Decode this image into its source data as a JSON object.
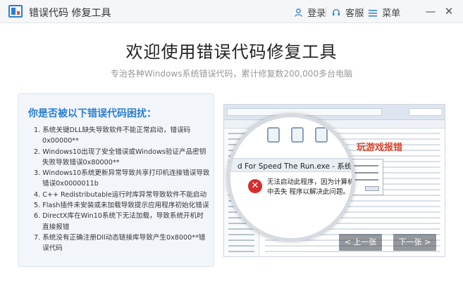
{
  "titlebar": {
    "app_title": "错误代码 修复工具",
    "login_label": "登录",
    "support_label": "客服",
    "menu_label": "菜单",
    "minimize_glyph": "—",
    "close_glyph": "✕"
  },
  "header": {
    "title": "欢迎使用错误代码修复工具",
    "subtitle": "专治各种Windows系统错误代码，累计修复数200,000多台电脑"
  },
  "issues_panel": {
    "title": "你是否被以下错误代码困扰：",
    "items": [
      "1. 系统关键DLL缺失导致软件不能正常启动，错误码0x00000**",
      "2. Windows10出现了安全错误或Windows验证产品密钥失败导致错误0x80000**",
      "3. Windows10系统更新异常导致共享打印机连接错误导致错误0x0000011b",
      "4. C++ Redistributable运行时库异常导致软件不能启动",
      "5. Flash插件未安装或未加载导致提示应用程序初始化错误",
      "6. DirectX库在Win10系统下无法加载，导致系统开机时直接报错",
      "7. 系统没有正确注册Dll动态链接库导致产生0x8000**错误代码"
    ]
  },
  "preview": {
    "magnifier_heading": "d For Speed The Run.exe - 系统错误",
    "error_message": "无法启动此程序，因为计算机中丢失 程序以解决此问题。",
    "category_label": "玩游戏报错",
    "prev_label": "上一张",
    "next_label": "下一张"
  },
  "icons": {
    "login": "user-icon",
    "support": "headset-icon",
    "menu": "menu-icon",
    "error": "error-x-icon"
  },
  "colors": {
    "accent": "#2b7fd1",
    "error": "#d62e2e",
    "category": "#d9442d"
  }
}
